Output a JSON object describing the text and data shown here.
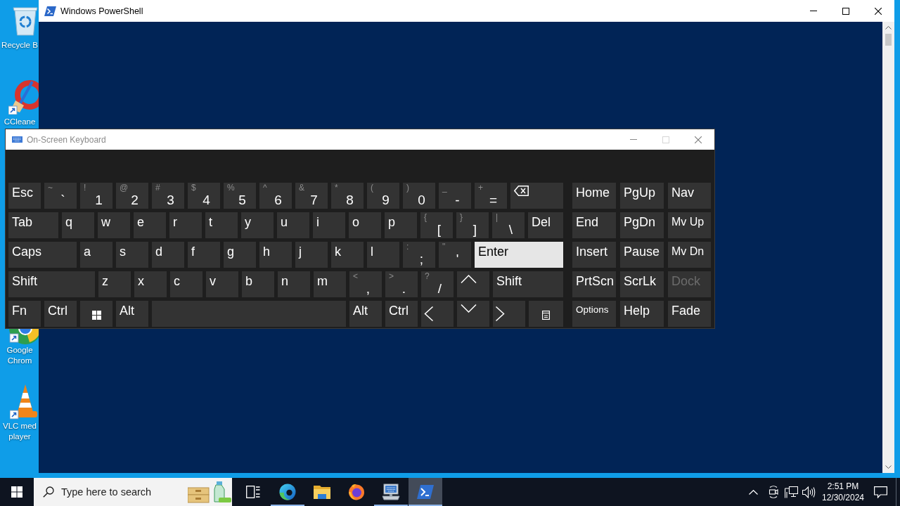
{
  "desktop": {
    "icons": [
      {
        "label": "Recycle B"
      },
      {
        "label": "CCleane"
      },
      {
        "label": "Google Chrom"
      },
      {
        "label": "VLC med player"
      }
    ]
  },
  "powershell": {
    "title": "Windows PowerShell",
    "active": true,
    "can_maximize": true
  },
  "osk": {
    "title": "On-Screen Keyboard",
    "active": false,
    "can_maximize": false,
    "rows": [
      {
        "keys": [
          {
            "kind": "text",
            "label": "Esc",
            "highlighted": false
          },
          {
            "kind": "dual",
            "shift": "~",
            "label": "`",
            "highlighted": false
          },
          {
            "kind": "dual",
            "shift": "!",
            "label": "1",
            "highlighted": false
          },
          {
            "kind": "dual",
            "shift": "@",
            "label": "2",
            "highlighted": false
          },
          {
            "kind": "dual",
            "shift": "#",
            "label": "3",
            "highlighted": false
          },
          {
            "kind": "dual",
            "shift": "$",
            "label": "4",
            "highlighted": false
          },
          {
            "kind": "dual",
            "shift": "%",
            "label": "5",
            "highlighted": false
          },
          {
            "kind": "dual",
            "shift": "^",
            "label": "6",
            "highlighted": false
          },
          {
            "kind": "dual",
            "shift": "&",
            "label": "7",
            "highlighted": false
          },
          {
            "kind": "dual",
            "shift": "*",
            "label": "8",
            "highlighted": false
          },
          {
            "kind": "dual",
            "shift": "(",
            "label": "9",
            "highlighted": false
          },
          {
            "kind": "dual",
            "shift": ")",
            "label": "0",
            "highlighted": false
          },
          {
            "kind": "dual",
            "shift": "_",
            "label": "-",
            "highlighted": false
          },
          {
            "kind": "dual",
            "shift": "+",
            "label": "=",
            "highlighted": false
          },
          {
            "kind": "backspace",
            "highlighted": false
          }
        ]
      },
      {
        "keys": [
          {
            "kind": "text",
            "label": "Tab",
            "highlighted": false
          },
          {
            "kind": "text",
            "label": "q",
            "highlighted": false
          },
          {
            "kind": "text",
            "label": "w",
            "highlighted": false
          },
          {
            "kind": "text",
            "label": "e",
            "highlighted": false
          },
          {
            "kind": "text",
            "label": "r",
            "highlighted": false
          },
          {
            "kind": "text",
            "label": "t",
            "highlighted": false
          },
          {
            "kind": "text",
            "label": "y",
            "highlighted": false
          },
          {
            "kind": "text",
            "label": "u",
            "highlighted": false
          },
          {
            "kind": "text",
            "label": "i",
            "highlighted": false
          },
          {
            "kind": "text",
            "label": "o",
            "highlighted": false
          },
          {
            "kind": "text",
            "label": "p",
            "highlighted": false
          },
          {
            "kind": "dual",
            "shift": "{",
            "label": "[",
            "highlighted": false
          },
          {
            "kind": "dual",
            "shift": "}",
            "label": "]",
            "highlighted": false
          },
          {
            "kind": "dual",
            "shift": "|",
            "label": "\\",
            "highlighted": false
          },
          {
            "kind": "text",
            "label": "Del",
            "highlighted": false
          }
        ]
      },
      {
        "keys": [
          {
            "kind": "text",
            "label": "Caps",
            "highlighted": false
          },
          {
            "kind": "text",
            "label": "a",
            "highlighted": false
          },
          {
            "kind": "text",
            "label": "s",
            "highlighted": false
          },
          {
            "kind": "text",
            "label": "d",
            "highlighted": false
          },
          {
            "kind": "text",
            "label": "f",
            "highlighted": false
          },
          {
            "kind": "text",
            "label": "g",
            "highlighted": false
          },
          {
            "kind": "text",
            "label": "h",
            "highlighted": false
          },
          {
            "kind": "text",
            "label": "j",
            "highlighted": false
          },
          {
            "kind": "text",
            "label": "k",
            "highlighted": false
          },
          {
            "kind": "text",
            "label": "l",
            "highlighted": false
          },
          {
            "kind": "dual",
            "shift": ":",
            "label": ";",
            "highlighted": false
          },
          {
            "kind": "dual",
            "shift": "\"",
            "label": "'",
            "highlighted": false
          },
          {
            "kind": "text",
            "label": "Enter",
            "highlighted": true
          }
        ]
      },
      {
        "keys": [
          {
            "kind": "text",
            "label": "Shift",
            "highlighted": false
          },
          {
            "kind": "text",
            "label": "z",
            "highlighted": false
          },
          {
            "kind": "text",
            "label": "x",
            "highlighted": false
          },
          {
            "kind": "text",
            "label": "c",
            "highlighted": false
          },
          {
            "kind": "text",
            "label": "v",
            "highlighted": false
          },
          {
            "kind": "text",
            "label": "b",
            "highlighted": false
          },
          {
            "kind": "text",
            "label": "n",
            "highlighted": false
          },
          {
            "kind": "text",
            "label": "m",
            "highlighted": false
          },
          {
            "kind": "dual",
            "shift": "<",
            "label": ",",
            "highlighted": false
          },
          {
            "kind": "dual",
            "shift": ">",
            "label": ".",
            "highlighted": false
          },
          {
            "kind": "dual",
            "shift": "?",
            "label": "/",
            "highlighted": false
          },
          {
            "kind": "arrow-up",
            "highlighted": false
          },
          {
            "kind": "text",
            "label": "Shift",
            "highlighted": false
          }
        ]
      },
      {
        "keys": [
          {
            "kind": "text",
            "label": "Fn",
            "highlighted": false
          },
          {
            "kind": "text",
            "label": "Ctrl",
            "highlighted": false
          },
          {
            "kind": "win",
            "highlighted": false
          },
          {
            "kind": "text",
            "label": "Alt",
            "highlighted": false
          },
          {
            "kind": "space",
            "highlighted": false
          },
          {
            "kind": "text",
            "label": "Alt",
            "highlighted": false
          },
          {
            "kind": "text",
            "label": "Ctrl",
            "highlighted": false
          },
          {
            "kind": "arrow-left",
            "highlighted": false
          },
          {
            "kind": "arrow-down",
            "highlighted": false
          },
          {
            "kind": "arrow-right",
            "highlighted": false
          },
          {
            "kind": "menu",
            "highlighted": false
          }
        ]
      }
    ],
    "side_keys": [
      {
        "label": "Home",
        "disabled": false
      },
      {
        "label": "PgUp",
        "disabled": false
      },
      {
        "label": "Nav",
        "disabled": false
      },
      {
        "label": "End",
        "disabled": false
      },
      {
        "label": "PgDn",
        "disabled": false
      },
      {
        "label": "Mv Up",
        "disabled": false
      },
      {
        "label": "Insert",
        "disabled": false
      },
      {
        "label": "Pause",
        "disabled": false
      },
      {
        "label": "Mv Dn",
        "disabled": false
      },
      {
        "label": "PrtScn",
        "disabled": false
      },
      {
        "label": "ScrLk",
        "disabled": false
      },
      {
        "label": "Dock",
        "disabled": true
      },
      {
        "label": "Options",
        "disabled": false
      },
      {
        "label": "Help",
        "disabled": false
      },
      {
        "label": "Fade",
        "disabled": false
      }
    ]
  },
  "taskbar": {
    "search": {
      "placeholder": "Type here to search"
    },
    "apps": [
      {
        "running": true,
        "active": false
      },
      {
        "running": false,
        "active": false
      },
      {
        "running": false,
        "active": false
      },
      {
        "running": true,
        "active": false
      },
      {
        "running": true,
        "active": true
      }
    ],
    "clock": {
      "time": "2:51 PM",
      "date": "12/30/2024"
    }
  }
}
